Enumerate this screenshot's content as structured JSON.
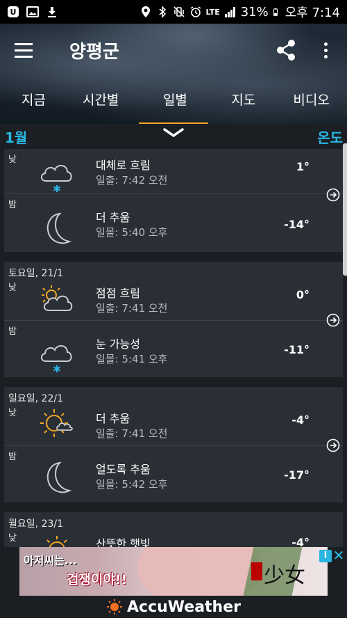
{
  "status_bar": {
    "battery": "31%",
    "time": "오후 7:14",
    "network": "LTE"
  },
  "header": {
    "city": "양평군",
    "tabs": [
      {
        "label": "지금"
      },
      {
        "label": "시간별"
      },
      {
        "label": "일별",
        "active": true
      },
      {
        "label": "지도"
      },
      {
        "label": "비디오"
      }
    ]
  },
  "subbar": {
    "month": "1월",
    "right_label": "온도"
  },
  "days": [
    {
      "date": "",
      "day": {
        "period": "낮",
        "icon": "cloud-snow-icon",
        "condition": "대체로 흐림",
        "sun": "일출: 7:42 오전",
        "temp": "1°"
      },
      "night": {
        "period": "밤",
        "icon": "moon-icon",
        "condition": "더 추움",
        "sun": "일몰: 5:40 오후",
        "temp": "-14°"
      }
    },
    {
      "date": "토요일, 21/1",
      "day": {
        "period": "낮",
        "icon": "partly-cloudy-icon",
        "condition": "점점 흐림",
        "sun": "일출: 7:41 오전",
        "temp": "0°"
      },
      "night": {
        "period": "밤",
        "icon": "cloud-snow-icon",
        "condition": "눈 가능성",
        "sun": "일몰: 5:41 오후",
        "temp": "-11°"
      }
    },
    {
      "date": "일요일, 22/1",
      "day": {
        "period": "낮",
        "icon": "sun-cloud-icon",
        "condition": "더 추움",
        "sun": "일출: 7:41 오전",
        "temp": "-4°"
      },
      "night": {
        "period": "밤",
        "icon": "moon-icon",
        "condition": "얼도록 추움",
        "sun": "일몰: 5:42 오후",
        "temp": "-17°"
      }
    },
    {
      "date": "월요일, 23/1",
      "day": {
        "period": "낮",
        "icon": "sun-icon",
        "condition": "산뜻한 햇빛",
        "sun": "",
        "temp": "-4°"
      }
    }
  ],
  "ad": {
    "line1": "아저씨는...",
    "line2": "겁쟁이야!!",
    "title": "少女",
    "choice_icon": "ad-choices-icon",
    "close_icon": "close-icon"
  },
  "footer": {
    "brand": "AccuWeather",
    "logo_icon": "sun-logo-icon"
  },
  "colors": {
    "accent": "#2ab6e3",
    "tab_indicator": "#f5a623",
    "sun_orange": "#f5a623",
    "card_bg": "#2a2f36"
  }
}
